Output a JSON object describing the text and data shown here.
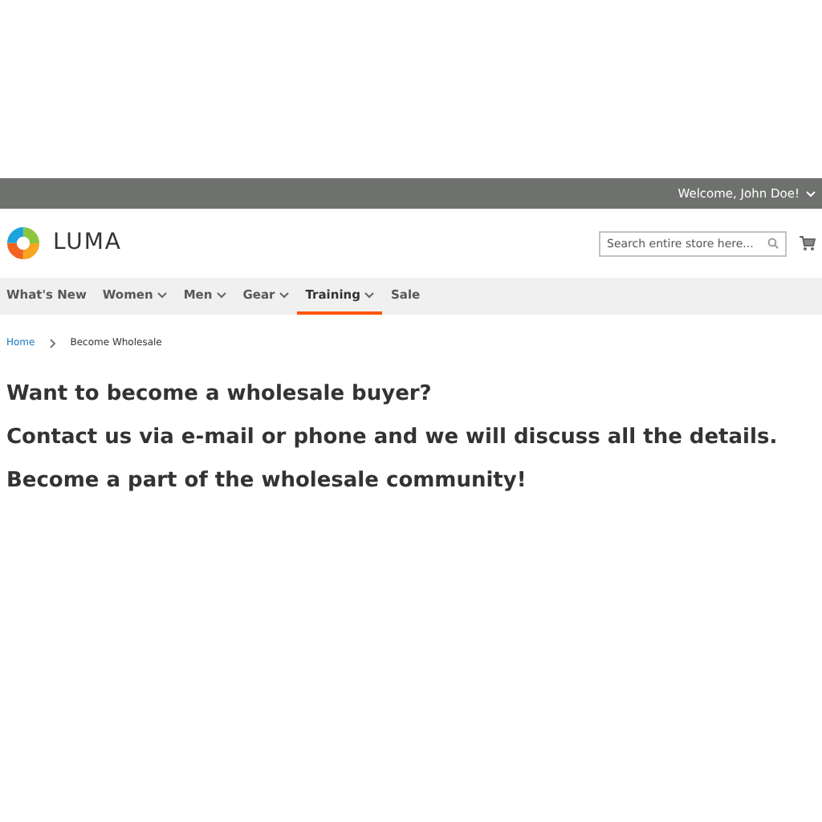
{
  "top_bar": {
    "welcome": "Welcome, John Doe!"
  },
  "header": {
    "logo_text": "LUMA",
    "search": {
      "placeholder": "Search entire store here..."
    }
  },
  "nav": [
    {
      "label": "What's New",
      "dropdown": false,
      "selected": false
    },
    {
      "label": "Women",
      "dropdown": true,
      "selected": false
    },
    {
      "label": "Men",
      "dropdown": true,
      "selected": false
    },
    {
      "label": "Gear",
      "dropdown": true,
      "selected": false
    },
    {
      "label": "Training",
      "dropdown": true,
      "selected": true
    },
    {
      "label": "Sale",
      "dropdown": false,
      "selected": false
    }
  ],
  "breadcrumbs": [
    "Home",
    "Become Wholesale"
  ],
  "content": [
    "Want to become a wholesale buyer?",
    "Contact us via e-mail or phone and we will discuss all the details.",
    "Become a part of the wholesale community!"
  ]
}
